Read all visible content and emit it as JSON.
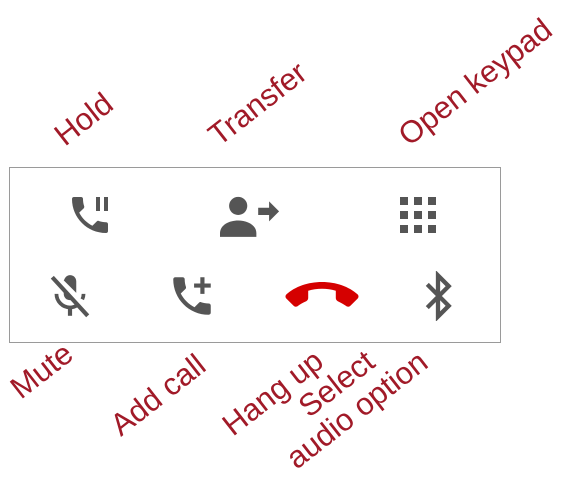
{
  "callControls": {
    "hold": {
      "label": "Hold",
      "icon": "call-hold-icon"
    },
    "transfer": {
      "label": "Transfer",
      "icon": "person-arrow-icon"
    },
    "keypad": {
      "label": "Open keypad",
      "icon": "dialpad-icon"
    },
    "mute": {
      "label": "Mute",
      "icon": "mic-off-icon"
    },
    "addCall": {
      "label": "Add call",
      "icon": "add-call-icon"
    },
    "hangUp": {
      "label": "Hang up",
      "icon": "call-end-icon"
    },
    "audio": {
      "label": "Select audio option",
      "icon": "bluetooth-icon"
    }
  },
  "colors": {
    "label": "#a11a28",
    "icon": "#555555",
    "hangUp": "#d50000",
    "border": "#9a9a9a"
  }
}
